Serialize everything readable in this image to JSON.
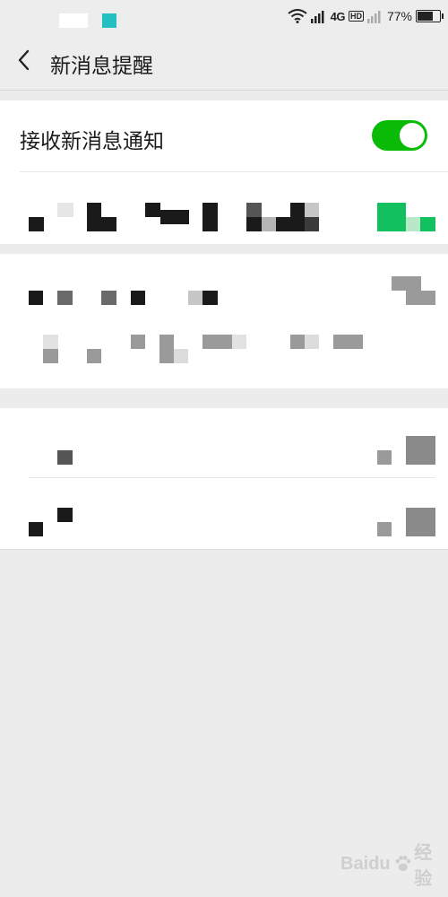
{
  "status_bar": {
    "network": "4G",
    "hd_badge": "HD",
    "battery": "77%",
    "battery_level": 0.77,
    "icons": [
      "wifi-icon",
      "signal-icon",
      "signal-weak-icon",
      "battery-icon"
    ]
  },
  "header": {
    "back_icon": "chevron-left-icon",
    "title": "新消息提醒"
  },
  "settings": {
    "receive_notifications": {
      "label": "接收新消息通知",
      "enabled": true
    }
  },
  "colors": {
    "background": "#ececec",
    "card": "#ffffff",
    "toggle_on": "#09bb07",
    "teal_indicator": "#22c0c0"
  },
  "watermark": {
    "brand": "Baidu",
    "suffix": "经验"
  }
}
